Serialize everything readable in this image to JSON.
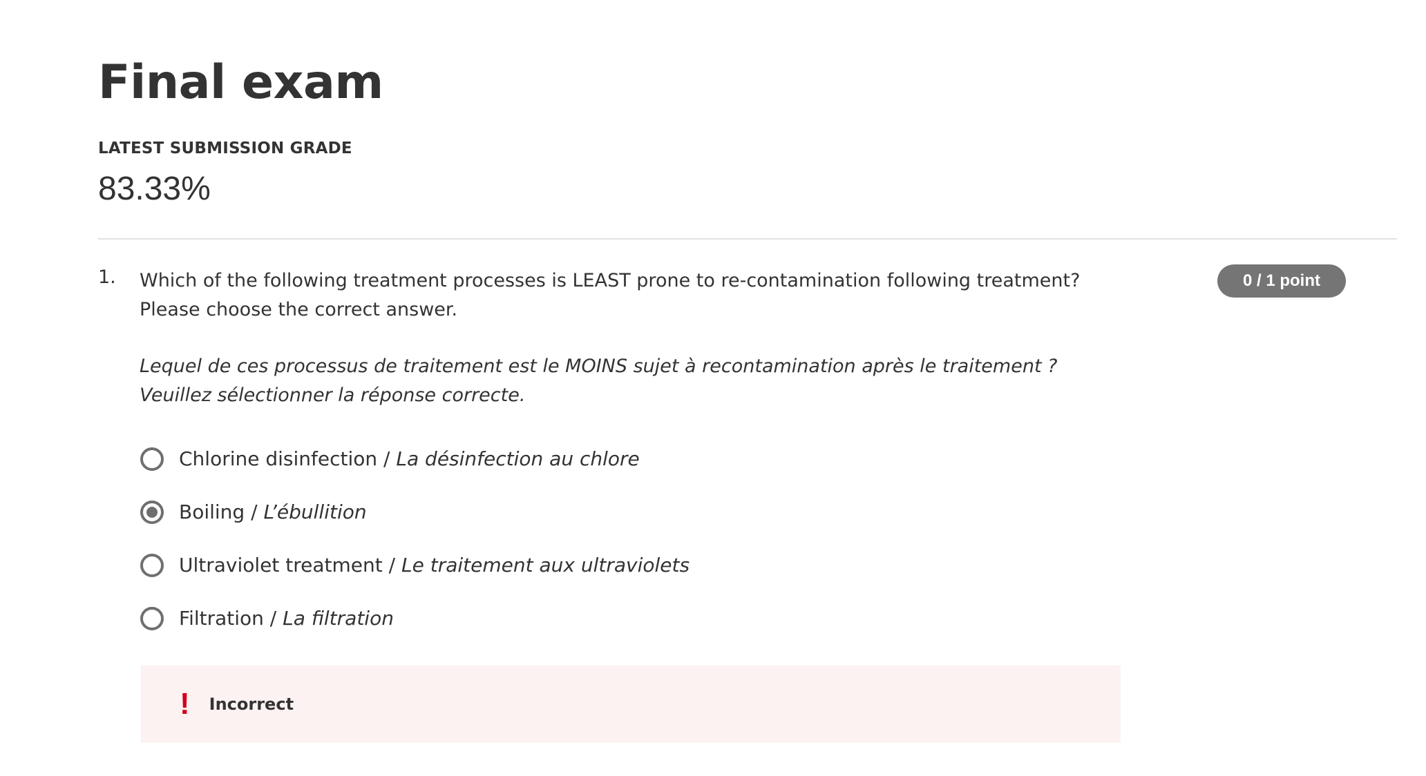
{
  "page": {
    "title": "Final exam"
  },
  "grade": {
    "label": "LATEST SUBMISSION GRADE",
    "value": "83.33%"
  },
  "question": {
    "number": "1.",
    "text_en": "Which of the following treatment processes is LEAST prone to re-contamination following treatment? Please choose the correct answer.",
    "text_fr": "Lequel de ces processus de traitement est le MOINS sujet à recontamination après le traitement ? Veuillez sélectionner la réponse correcte.",
    "points": "0 / 1 point",
    "options": [
      {
        "en": "Chlorine disinfection / ",
        "fr": "La désinfection au chlore",
        "selected": false
      },
      {
        "en": "Boiling / ",
        "fr": "L’ébullition",
        "selected": true
      },
      {
        "en": "Ultraviolet treatment / ",
        "fr": "Le traitement aux ultraviolets",
        "selected": false
      },
      {
        "en": "Filtration / ",
        "fr": "La filtration",
        "selected": false
      }
    ],
    "feedback": {
      "icon": "exclamation-icon",
      "icon_glyph": "!",
      "text": "Incorrect"
    }
  },
  "colors": {
    "text": "#333333",
    "badge_bg": "#757575",
    "feedback_bg": "#fdf2f2",
    "error": "#d0021b"
  }
}
